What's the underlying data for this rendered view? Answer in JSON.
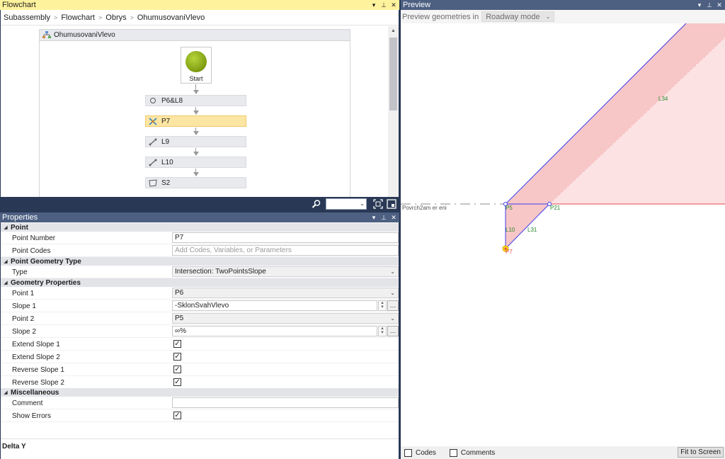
{
  "flowchart": {
    "title": "Flowchart",
    "breadcrumb": [
      "Subassembly",
      "Flowchart",
      "Obrys",
      "OhumusovaniVlevo"
    ],
    "subassembly_name": "OhumusovaniVlevo",
    "start_label": "Start",
    "items": [
      {
        "label": "P6&L8",
        "icon": "circle-icon"
      },
      {
        "label": "P7",
        "icon": "intersection-point-icon"
      },
      {
        "label": "L9",
        "icon": "link-icon"
      },
      {
        "label": "L10",
        "icon": "link-icon"
      },
      {
        "label": "S2",
        "icon": "shape-icon"
      }
    ],
    "selected_item": "P7"
  },
  "properties": {
    "title": "Properties",
    "categories": {
      "point": "Point",
      "geometry_type": "Point Geometry Type",
      "geometry_props": "Geometry Properties",
      "misc": "Miscellaneous"
    },
    "rows": {
      "point_number": {
        "name": "Point Number",
        "value": "P7"
      },
      "point_codes": {
        "name": "Point Codes",
        "placeholder": "Add Codes, Variables, or Parameters"
      },
      "type": {
        "name": "Type",
        "value": "Intersection: TwoPointsSlope"
      },
      "point1": {
        "name": "Point 1",
        "value": "P6"
      },
      "slope1": {
        "name": "Slope 1",
        "value": "-SklonSvahVlevo"
      },
      "point2": {
        "name": "Point 2",
        "value": "P5"
      },
      "slope2": {
        "name": "Slope 2",
        "value": "∞%"
      },
      "extend_slope1": {
        "name": "Extend Slope 1",
        "checked": true
      },
      "extend_slope2": {
        "name": "Extend Slope 2",
        "checked": true
      },
      "reverse_slope1": {
        "name": "Reverse Slope 1",
        "checked": true
      },
      "reverse_slope2": {
        "name": "Reverse Slope 2",
        "checked": true
      },
      "comment": {
        "name": "Comment",
        "value": ""
      },
      "show_errors": {
        "name": "Show Errors",
        "checked": true
      }
    },
    "description_title": "Delta Y"
  },
  "preview": {
    "title": "Preview",
    "geometries_label": "Preview geometries in",
    "mode": "Roadway mode",
    "surface_label": "Povrch2am er eni",
    "point_labels": {
      "p5": "P5",
      "p21": "P21",
      "p7": "P7"
    },
    "link_labels": {
      "l34": "L34",
      "l10": "L10",
      "l31": "L31"
    },
    "footer": {
      "codes": "Codes",
      "comments": "Comments",
      "fit": "Fit to Screen"
    }
  },
  "colors": {
    "panel_bg": "#293955",
    "active_title": "#fff29d",
    "selected_item": "#fde6a3",
    "shape_fill": "#f7c6c6",
    "link_blue": "#3e3ef0",
    "surface_red": "#e84848"
  }
}
